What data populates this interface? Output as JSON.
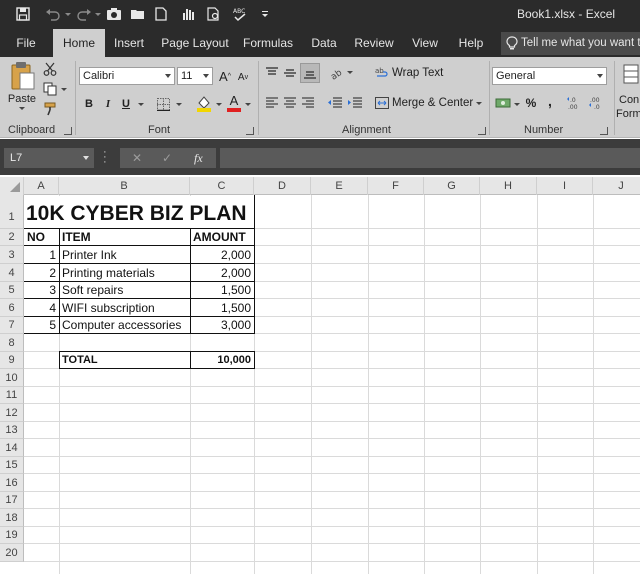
{
  "window": {
    "title": "Book1.xlsx  -  Excel"
  },
  "ribbon_tabs": [
    {
      "label": "File",
      "active": false
    },
    {
      "label": "Home",
      "active": true
    },
    {
      "label": "Insert",
      "active": false
    },
    {
      "label": "Page Layout",
      "active": false
    },
    {
      "label": "Formulas",
      "active": false
    },
    {
      "label": "Data",
      "active": false
    },
    {
      "label": "Review",
      "active": false
    },
    {
      "label": "View",
      "active": false
    },
    {
      "label": "Help",
      "active": false
    }
  ],
  "tell_me": {
    "placeholder": "Tell me what you want to"
  },
  "ribbon": {
    "clipboard": {
      "paste_label": "Paste",
      "group_label": "Clipboard"
    },
    "font": {
      "font_name": "Calibri",
      "font_size": "11",
      "bold": "B",
      "italic": "I",
      "underline": "U",
      "grow": "A",
      "shrink": "A",
      "font_color": "A",
      "group_label": "Font"
    },
    "alignment": {
      "wrap_text": "Wrap Text",
      "merge_center": "Merge & Center",
      "group_label": "Alignment"
    },
    "number": {
      "format": "General",
      "percent": "%",
      "comma": ",",
      "group_label": "Number"
    },
    "styles": {
      "conditional_line1": "Con",
      "conditional_line2": "Form"
    }
  },
  "formula_bar": {
    "name_box": "L7",
    "cancel": "✕",
    "enter": "✓",
    "fx": "fx",
    "content": ""
  },
  "sheet": {
    "column_headers": [
      "A",
      "B",
      "C",
      "D",
      "E",
      "F",
      "G",
      "H",
      "I",
      "J"
    ],
    "row_headers": [
      "1",
      "2",
      "3",
      "4",
      "5",
      "6",
      "7",
      "8",
      "9",
      "10",
      "11",
      "12",
      "13",
      "14",
      "15",
      "16",
      "17",
      "18",
      "19",
      "20"
    ],
    "title": "10K CYBER BIZ PLAN",
    "headers": {
      "no": "NO",
      "item": "ITEM",
      "amount": "AMOUNT"
    },
    "rows": [
      {
        "no": "1",
        "item": "Printer Ink",
        "amount": "2,000"
      },
      {
        "no": "2",
        "item": "Printing materials",
        "amount": "2,000"
      },
      {
        "no": "3",
        "item": "Soft repairs",
        "amount": "1,500"
      },
      {
        "no": "4",
        "item": "WIFI subscription",
        "amount": "1,500"
      },
      {
        "no": "5",
        "item": "Computer accessories",
        "amount": "3,000"
      }
    ],
    "total": {
      "label": "TOTAL",
      "amount": "10,000"
    }
  },
  "colors": {
    "titlebar_bg": "#2b2b2b",
    "ribbon_bg": "#cfcfcf",
    "font_color_accent": "#e02020",
    "fill_color_accent": "#f2d600"
  }
}
